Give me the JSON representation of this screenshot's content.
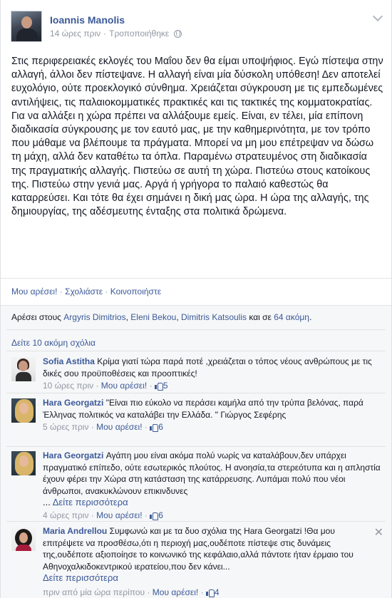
{
  "post": {
    "author": "Ioannis Manolis",
    "time": "14 ώρες πριν",
    "edited": "Τροποποιήθηκε",
    "text": "Στις περιφερειακές εκλογές του Μαΐου δεν θα είμαι υποψήφιος. Εγώ πίστεψα στην αλλαγή, άλλοι δεν πίστεψανε. Η αλλαγή είναι μία δύσκολη υπόθεση! Δεν αποτελεί ευχολόγιο, ούτε προεκλογικό σύνθημα. Χρειάζεται σύγκρουση με τις εμπεδωμένες αντιλήψεις, τις παλαιοκομματικές πρακτικές και τις τακτικές της κομματοκρατίας. Για να αλλάξει η χώρα πρέπει να αλλάξουμε εμείς. Είναι, εν τέλει, μία επίπονη διαδικασία σύγκρουσης με τον εαυτό μας, με την καθημερινότητα, με τον τρόπο που μάθαμε να βλέπουμε τα πράγματα. Μπορεί να μη μου επέτρεψαν να δώσω τη μάχη, αλλά δεν καταθέτω τα όπλα. Παραμένω στρατευμένος στη διαδικασία της πραγματικής αλλαγής. Πιστεύω σε αυτή τη χώρα. Πιστεύω στους κατοίκους της. Πιστεύω στην γενιά μας. Αργά ή γρήγορα το παλαιό καθεστώς θα καταρρεύσει. Και τότε θα έχει σημάνει η δική μας ώρα. Η ώρα της αλλαγής, της δημιουργίας, της αδέσμευτης ένταξης στα πολιτικά δρώμενα."
  },
  "actions": {
    "like": "Μου αρέσει!",
    "comment": "Σχολιάστε",
    "share": "Κοινοποιήστε",
    "sep": " · "
  },
  "likes": {
    "prefix": "Αρέσει στους ",
    "name1": "Argyris Dimitrios",
    "name2": "Eleni Bekou",
    "name3": "Dimitris Katsoulis",
    "and": " και σε ",
    "more": "64 ακόμη",
    "suffix": "."
  },
  "more_comments": "Δείτε 10 ακόμη σχόλια",
  "see_more": "Δείτε περισσότερα",
  "comments": [
    {
      "name": "Sofia Astitha",
      "text": " Κρίμα γιατί τώρα παρά ποτέ ,χρειάζεται ο τόπος νέους ανθρώπους με τις δικές σου προϋποθέσεις και προοπτικές!",
      "time": "10 ώρες πριν",
      "like": "Μου αρέσει!",
      "count": "5"
    },
    {
      "name": "Hara Georgatzi",
      "text": " \"Είναι πιο εύκολο να περάσει καμήλα από την τρύπα βελόνας, παρά Έλληνας πολιτικός να καταλάβει την Ελλάδα. \" Γιώργος Σεφέρης",
      "time": "5 ώρες πριν",
      "like": "Μου αρέσει!",
      "count": "6"
    },
    {
      "name": "Hara Georgatzi",
      "text": " Αγάπη μου είναι ακόμα πολύ νωρίς να καταλάβουν,δεν υπάρχει πραγματικό επίπεδο, ούτε εσωτερικός πλούτος. Η ανοησία,τα στερεότυπα και η απληστία έχουν φέρει την Χώρα στη κατάσταση της κατάρρευσης. Λυπάμαι πολύ που νέοι άνθρωποι, ανακυκλώνουν επικινδυνες",
      "ellipsis": "... ",
      "time": "4 ώρες πριν",
      "like": "Μου αρέσει!",
      "count": "6"
    },
    {
      "name": "Maria Andrellou",
      "text": " Συμφωνώ και με τα δυο σχόλια της Hara Georgatzi !Θα μου επιτρέψετε να προσθέσω,ότι η περιοχή μας,ουδέποτε πίστεψε στις δυνάμεις της,ουδέποτε αξιοποίησε το κοινωνικό της κεφάλαιο,αλλά πάντοτε ήταν έρμαιο του Αθηνοχαλκιδοκεντρικού ιερατείου,που δεν κάνει...",
      "time": "πριν από μία ώρα περίπου",
      "like": "Μου αρέσει!",
      "count": "4"
    }
  ],
  "colors": {
    "link": "#3b5998",
    "muted": "#9197a3",
    "ufi_bg": "#f6f7f8"
  }
}
